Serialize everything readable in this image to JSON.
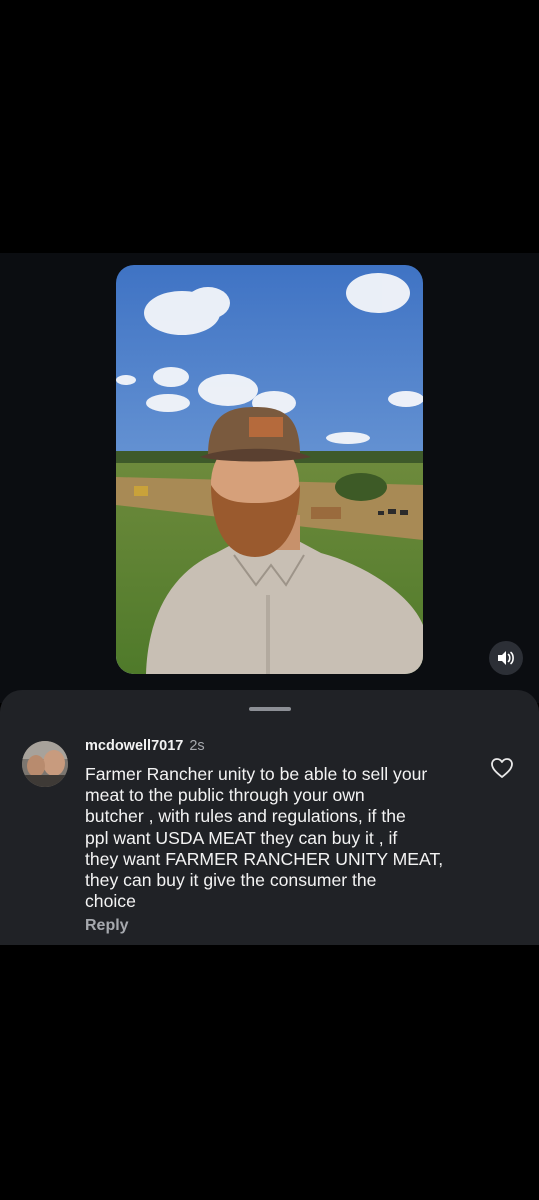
{
  "video": {
    "alt": "man with beard wearing cap in field"
  },
  "controls": {
    "sound_icon": "speaker-icon"
  },
  "comment": {
    "username": "mcdowell7017",
    "time": "2s",
    "text": "Farmer Rancher unity to be able to sell your\nmeat to the public through your own\nbutcher , with rules and regulations, if the\nppl want USDA MEAT they can buy it , if\nthey want FARMER RANCHER UNITY MEAT,\nthey can buy it give the consumer the\nchoice",
    "reply_label": "Reply",
    "like_icon": "heart-icon"
  },
  "colors": {
    "sheet": "#202226",
    "player_bg": "#0b0d11",
    "text": "#f3f3f3",
    "muted": "#a6a9ae"
  }
}
